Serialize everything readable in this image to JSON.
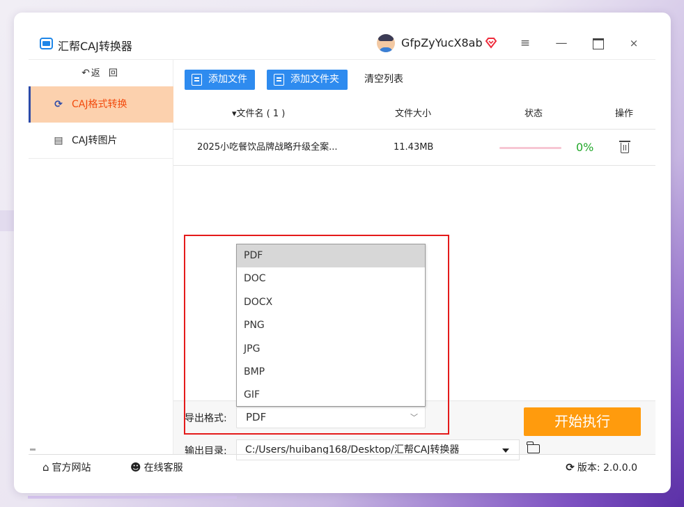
{
  "app": {
    "title": "汇帮CAJ转换器",
    "username": "GfpZyYucX8ab"
  },
  "window_controls": {
    "menu": "≡",
    "minimize": "—",
    "close": "×"
  },
  "sidebar": {
    "back_label": "返 回",
    "items": [
      {
        "label": "CAJ格式转换",
        "active": true
      },
      {
        "label": "CAJ转图片",
        "active": false
      }
    ]
  },
  "toolbar": {
    "add_file": "添加文件",
    "add_folder": "添加文件夹",
    "clear_list": "清空列表"
  },
  "table": {
    "headers": {
      "name": "▾文件名 ( 1 )",
      "size": "文件大小",
      "status": "状态",
      "op": "操作"
    },
    "rows": [
      {
        "name": "2025小吃餐饮品牌战略升级全案...",
        "size": "11.43MB",
        "progress": 0,
        "percent": "0%"
      }
    ]
  },
  "export": {
    "format_label": "导出格式:",
    "format_value": "PDF",
    "format_options": [
      "PDF",
      "DOC",
      "DOCX",
      "PNG",
      "JPG",
      "BMP",
      "GIF"
    ],
    "dir_label": "输出目录:",
    "dir_value": "C:/Users/huibang168/Desktop/汇帮CAJ转换器"
  },
  "start_button": "开始执行",
  "statusbar": {
    "home": "官方网站",
    "service": "在线客服",
    "version": "版本: 2.0.0.0"
  },
  "colors": {
    "primary": "#2e8bef",
    "active_nav_bg": "#fcd1ae",
    "active_nav_text": "#f24a0d",
    "start_button": "#ff9b0d",
    "highlight": "#e41a1a",
    "percent_text": "#22a82a"
  }
}
